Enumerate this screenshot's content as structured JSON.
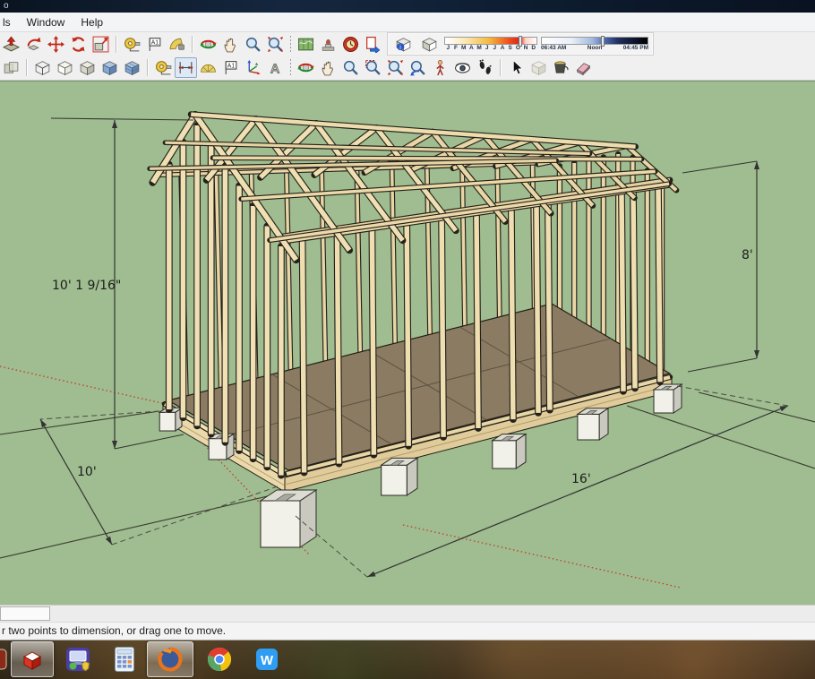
{
  "window": {
    "title": "o"
  },
  "menu": {
    "items": [
      "ls",
      "Window",
      "Help"
    ]
  },
  "toolbars": {
    "row1": {
      "groups": [
        {
          "icons": [
            "push-terrain",
            "rotate-object",
            "move",
            "refresh",
            "scale-box"
          ]
        },
        {
          "icons": [
            "tape-measure",
            "dimension-flag",
            "paint-shell"
          ]
        },
        {
          "icons": [
            "orbit",
            "pan",
            "zoom",
            "zoom-extents"
          ]
        },
        {
          "icons": [
            "map",
            "stamp",
            "time-red",
            "export"
          ],
          "sep": "dotted"
        }
      ],
      "shadow_panel": {
        "icons": [
          "shadow-settings",
          "shadow-toggle"
        ],
        "months": [
          "J",
          "F",
          "M",
          "A",
          "M",
          "J",
          "J",
          "A",
          "S",
          "O",
          "N",
          "D"
        ],
        "month_slider_pos": 0.82,
        "time_labels": {
          "start": "06:43 AM",
          "mid": "Noon",
          "end": "04:45 PM"
        },
        "time_slider_pos": 0.58
      }
    },
    "row2": {
      "groups": [
        {
          "icons": [
            "xray"
          ]
        },
        {
          "icons": [
            "wireframe",
            "hidden-line",
            "monochrome",
            "shaded",
            "shaded-textures"
          ]
        },
        {
          "icons": [
            "tape-measure",
            "dimension",
            "protractor",
            "text",
            "axes",
            "3d-text"
          ],
          "pressed": "dimension"
        },
        {
          "icons": [
            "orbit",
            "pan",
            "zoom",
            "zoom-window",
            "zoom-extents",
            "zoom-previous",
            "position-camera",
            "look-around",
            "walk"
          ],
          "sep": "dotted"
        },
        {
          "icons": [
            "select",
            "component",
            "paint-bucket",
            "eraser"
          ]
        }
      ]
    }
  },
  "viewport": {
    "dimensions": {
      "overall_height": "10' 1 9/16\"",
      "wall_height": "8'",
      "width": "10'",
      "length": "16'"
    },
    "colors": {
      "background": "#9fbd90",
      "lumber": "#efdfb2",
      "lumber_far": "#e7d5a5",
      "floor": "#8b7b63",
      "block": "#f1f1ea",
      "axis_red": "#c23b2e"
    }
  },
  "statusbar": {
    "message": "r two points to dimension, or drag one to move."
  },
  "taskbar": {
    "items": [
      {
        "name": "start-fragment",
        "active": false
      },
      {
        "name": "sketchup",
        "active": true
      },
      {
        "name": "games",
        "active": false
      },
      {
        "name": "calculator",
        "active": false
      },
      {
        "name": "firefox",
        "active": true
      },
      {
        "name": "chrome",
        "active": false
      },
      {
        "name": "writer",
        "active": false
      }
    ]
  }
}
